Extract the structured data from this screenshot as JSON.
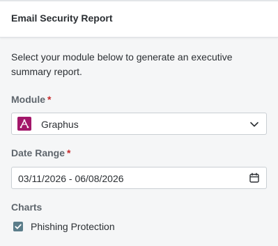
{
  "header": {
    "title": "Email Security Report"
  },
  "intro": {
    "text": "Select your module below to generate an executive summary report."
  },
  "module": {
    "label": "Module",
    "required_marker": "*",
    "selected_value": "Graphus",
    "icon": "graphus-logo-icon",
    "icon_color": "#a3176a"
  },
  "date_range": {
    "label": "Date Range",
    "required_marker": "*",
    "value": "03/11/2026 - 06/08/2026",
    "icon": "calendar-icon"
  },
  "charts": {
    "label": "Charts",
    "items": [
      {
        "label": "Phishing Protection",
        "checked": true
      }
    ]
  },
  "colors": {
    "required": "#c6292b",
    "checkbox": "#5b7d8a",
    "label": "#5f666d"
  }
}
